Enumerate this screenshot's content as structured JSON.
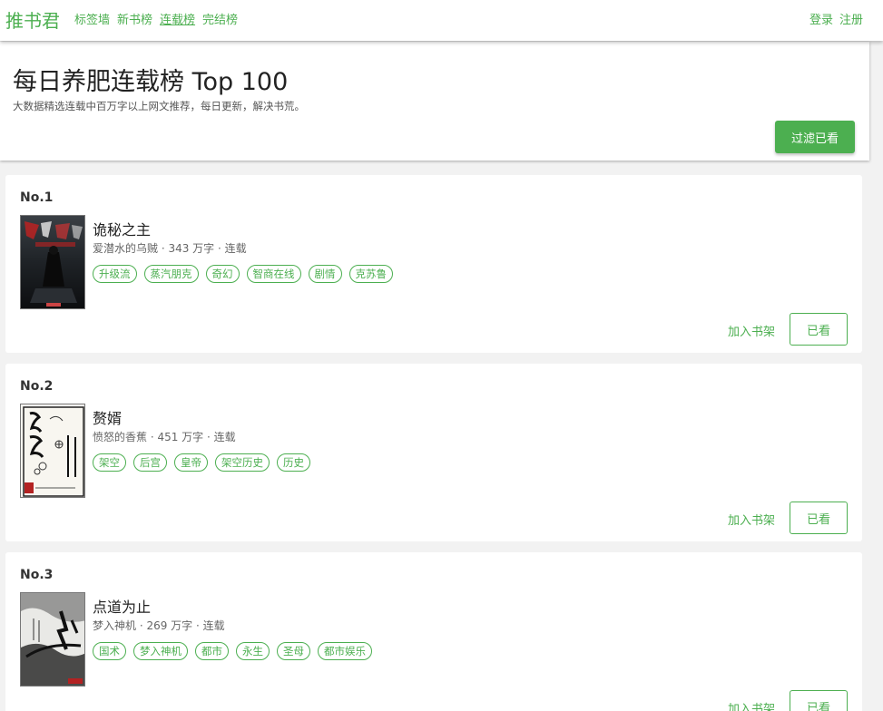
{
  "navbar": {
    "brand": "推书君",
    "links": [
      {
        "label": "标签墙"
      },
      {
        "label": "新书榜"
      },
      {
        "label": "连载榜"
      },
      {
        "label": "完结榜"
      }
    ],
    "active_link": "连载榜",
    "login": "登录",
    "register": "注册",
    "accent_color": "#4caf50"
  },
  "header": {
    "title": "每日养肥连载榜 Top 100",
    "subtitle": "大数据精选连载中百万字以上网文推荐，每日更新，解决书荒。",
    "filter_button": "过滤已看"
  },
  "actions": {
    "add_shelf": "加入书架",
    "read": "已看"
  },
  "books": [
    {
      "rank": "No.1",
      "title": "诡秘之主",
      "meta": "爱潜水的乌贼 · 343 万字 · 连载",
      "tags": [
        "升级流",
        "蒸汽朋克",
        "奇幻",
        "智商在线",
        "剧情",
        "克苏鲁"
      ],
      "cover_icon": "dark-fantasy-cover"
    },
    {
      "rank": "No.2",
      "title": "赘婿",
      "meta": "愤怒的香蕉 · 451 万字 · 连载",
      "tags": [
        "架空",
        "后宫",
        "皇帝",
        "架空历史",
        "历史"
      ],
      "cover_icon": "ink-calligraphy-cover"
    },
    {
      "rank": "No.3",
      "title": "点道为止",
      "meta": "梦入神机 · 269 万字 · 连载",
      "tags": [
        "国术",
        "梦入神机",
        "都市",
        "永生",
        "圣母",
        "都市娱乐"
      ],
      "cover_icon": "ink-wash-cover"
    }
  ]
}
